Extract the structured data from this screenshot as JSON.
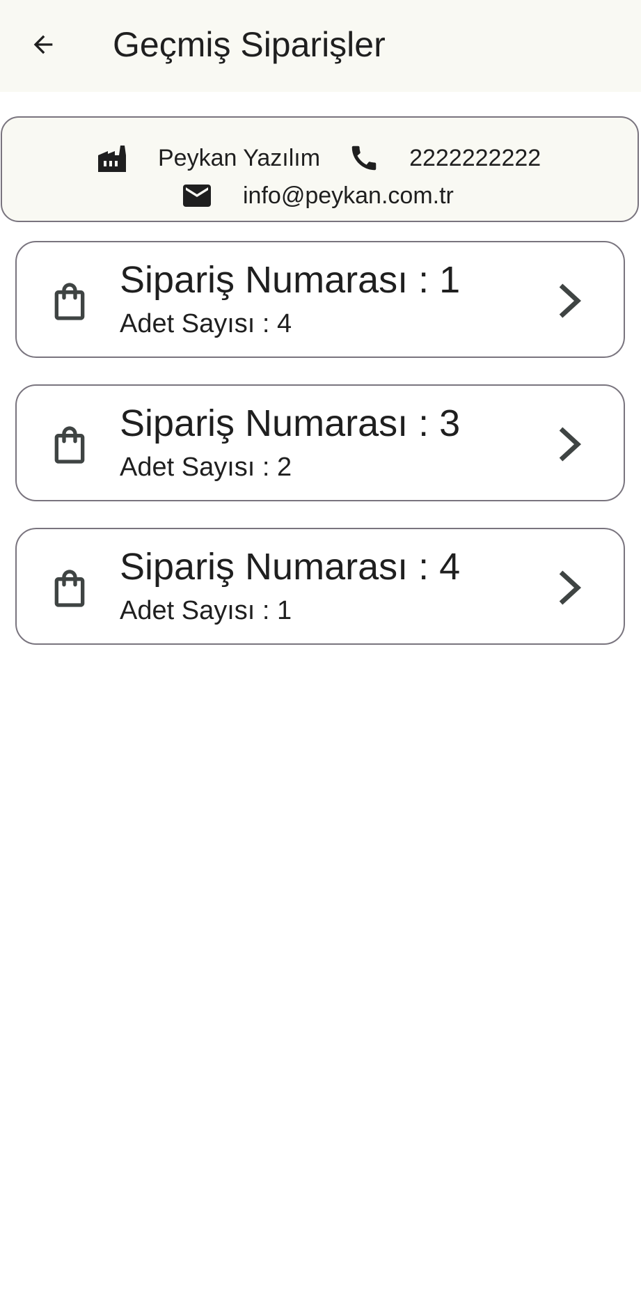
{
  "header": {
    "back_icon": "arrow-back-icon",
    "title": "Geçmiş Siparişler"
  },
  "company": {
    "name": "Peykan Yazılım",
    "name_icon": "factory-icon",
    "phone": "2222222222",
    "phone_icon": "phone-icon",
    "email": "info@peykan.com.tr",
    "email_icon": "mail-icon"
  },
  "orders": [
    {
      "title": "Sipariş Numarası : 1",
      "subtitle": "Adet Sayısı : 4",
      "icon": "shopping-bag-icon",
      "chevron": "chevron-right-icon"
    },
    {
      "title": "Sipariş Numarası : 3",
      "subtitle": "Adet Sayısı : 2",
      "icon": "shopping-bag-icon",
      "chevron": "chevron-right-icon"
    },
    {
      "title": "Sipariş Numarası : 4",
      "subtitle": "Adet Sayısı : 1",
      "icon": "shopping-bag-icon",
      "chevron": "chevron-right-icon"
    }
  ],
  "colors": {
    "appbar_bg": "#f9f9f3",
    "card_border": "#79747e",
    "icon": "#3f4443",
    "text": "#1f1f1f"
  }
}
